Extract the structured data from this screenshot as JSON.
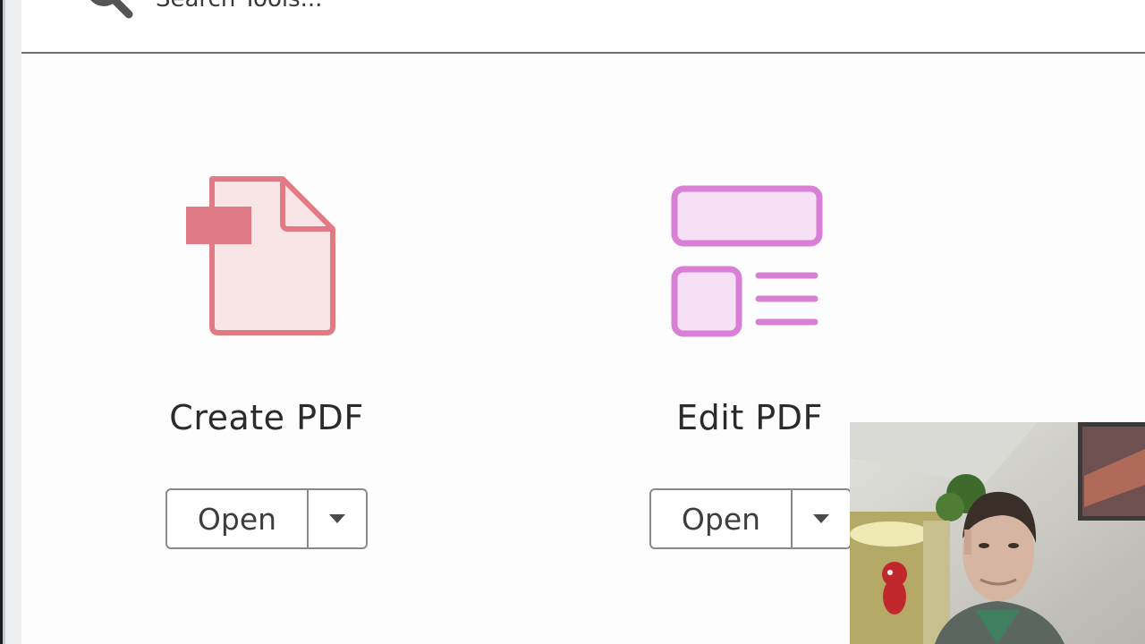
{
  "search": {
    "placeholder": "Search Tools..."
  },
  "tools": [
    {
      "title": "Create PDF",
      "open_label": "Open",
      "icon": "create-pdf-icon",
      "color": "#e07a84"
    },
    {
      "title": "Edit PDF",
      "open_label": "Open",
      "icon": "edit-pdf-icon",
      "color": "#d97fd5"
    }
  ],
  "icons": {
    "search": "search-icon",
    "dropdown": "chevron-down-icon"
  },
  "colors": {
    "text": "#2b2b2b",
    "border": "#8a8a8a",
    "divider": "#6e6e6e"
  }
}
